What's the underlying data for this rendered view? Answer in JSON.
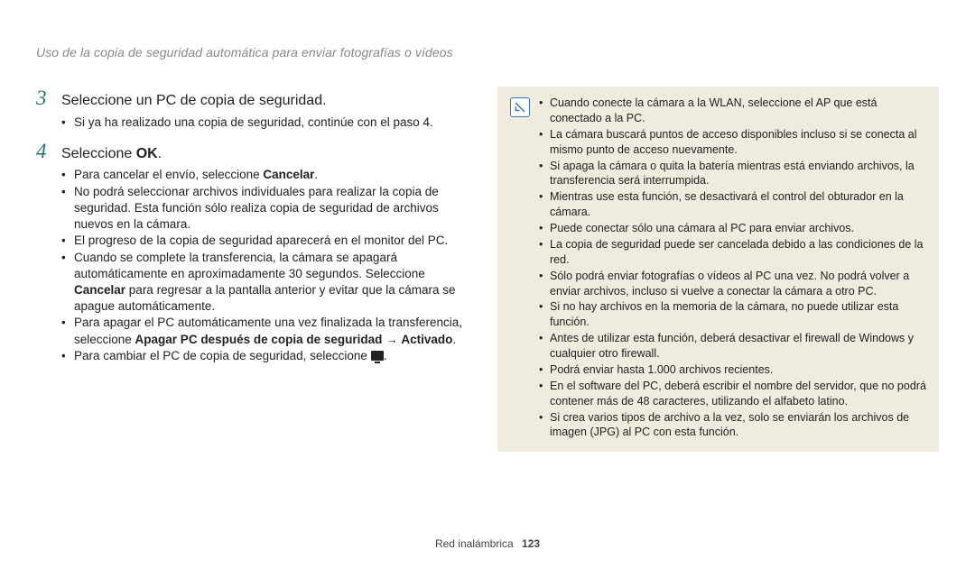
{
  "header": {
    "title": "Uso de la copia de seguridad automática para enviar fotografías o vídeos"
  },
  "steps": {
    "s3": {
      "num": "3",
      "text": "Seleccione un PC de copia de seguridad."
    },
    "s3_bullets": {
      "b0": "Si ya ha realizado una copia de seguridad, continúe con el paso 4."
    },
    "s4": {
      "num": "4",
      "pre": "Seleccione ",
      "bold": "OK",
      "post": "."
    },
    "s4_bullets": {
      "b0": {
        "pre": "Para cancelar el envío, seleccione ",
        "b": "Cancelar",
        "post": "."
      },
      "b1": "No podrá seleccionar archivos individuales para realizar la copia de seguridad. Esta función sólo realiza copia de seguridad de archivos nuevos en la cámara.",
      "b2": "El progreso de la copia de seguridad aparecerá en el monitor del PC.",
      "b3": {
        "pre": "Cuando se complete la transferencia, la cámara se apagará automáticamente en aproximadamente 30 segundos. Seleccione ",
        "b": "Cancelar",
        "post": " para regresar a la pantalla anterior y evitar que la cámara se apague automáticamente."
      },
      "b4": {
        "pre": "Para apagar el PC automáticamente una vez finalizada la transferencia, seleccione ",
        "b": "Apagar PC después de copia de seguridad",
        "arrow": " → ",
        "b2": "Activado",
        "post": "."
      },
      "b5": {
        "pre": "Para cambiar el PC de copia de seguridad, seleccione ",
        "post": "."
      }
    }
  },
  "notes": {
    "n0": "Cuando conecte la cámara a la WLAN, seleccione el AP que está conectado a la PC.",
    "n1": "La cámara buscará puntos de acceso disponibles incluso si se conecta al mismo punto de acceso nuevamente.",
    "n2": "Si apaga la cámara o quita la batería mientras está enviando archivos, la transferencia será interrumpida.",
    "n3": "Mientras use esta función, se desactivará el control del obturador en la cámara.",
    "n4": "Puede conectar sólo una cámara al PC para enviar archivos.",
    "n5": "La copia de seguridad puede ser cancelada debido a las condiciones de la red.",
    "n6": "Sólo podrá enviar fotografías o vídeos al PC una vez. No podrá volver a enviar archivos, incluso si vuelve a conectar la cámara a otro PC.",
    "n7": "Si no hay archivos en la memoria de la cámara, no puede utilizar esta función.",
    "n8": "Antes de utilizar esta función, deberá desactivar el firewall de Windows y cualquier otro firewall.",
    "n9": "Podrá enviar hasta 1.000 archivos recientes.",
    "n10": "En el software del PC, deberá escribir el nombre del servidor, que no podrá contener más de 48 caracteres, utilizando el alfabeto latino.",
    "n11": "Si crea varios tipos de archivo a la vez, solo se enviarán los archivos de imagen (JPG) al PC con esta función."
  },
  "footer": {
    "label": "Red inalámbrica",
    "page": "123"
  }
}
